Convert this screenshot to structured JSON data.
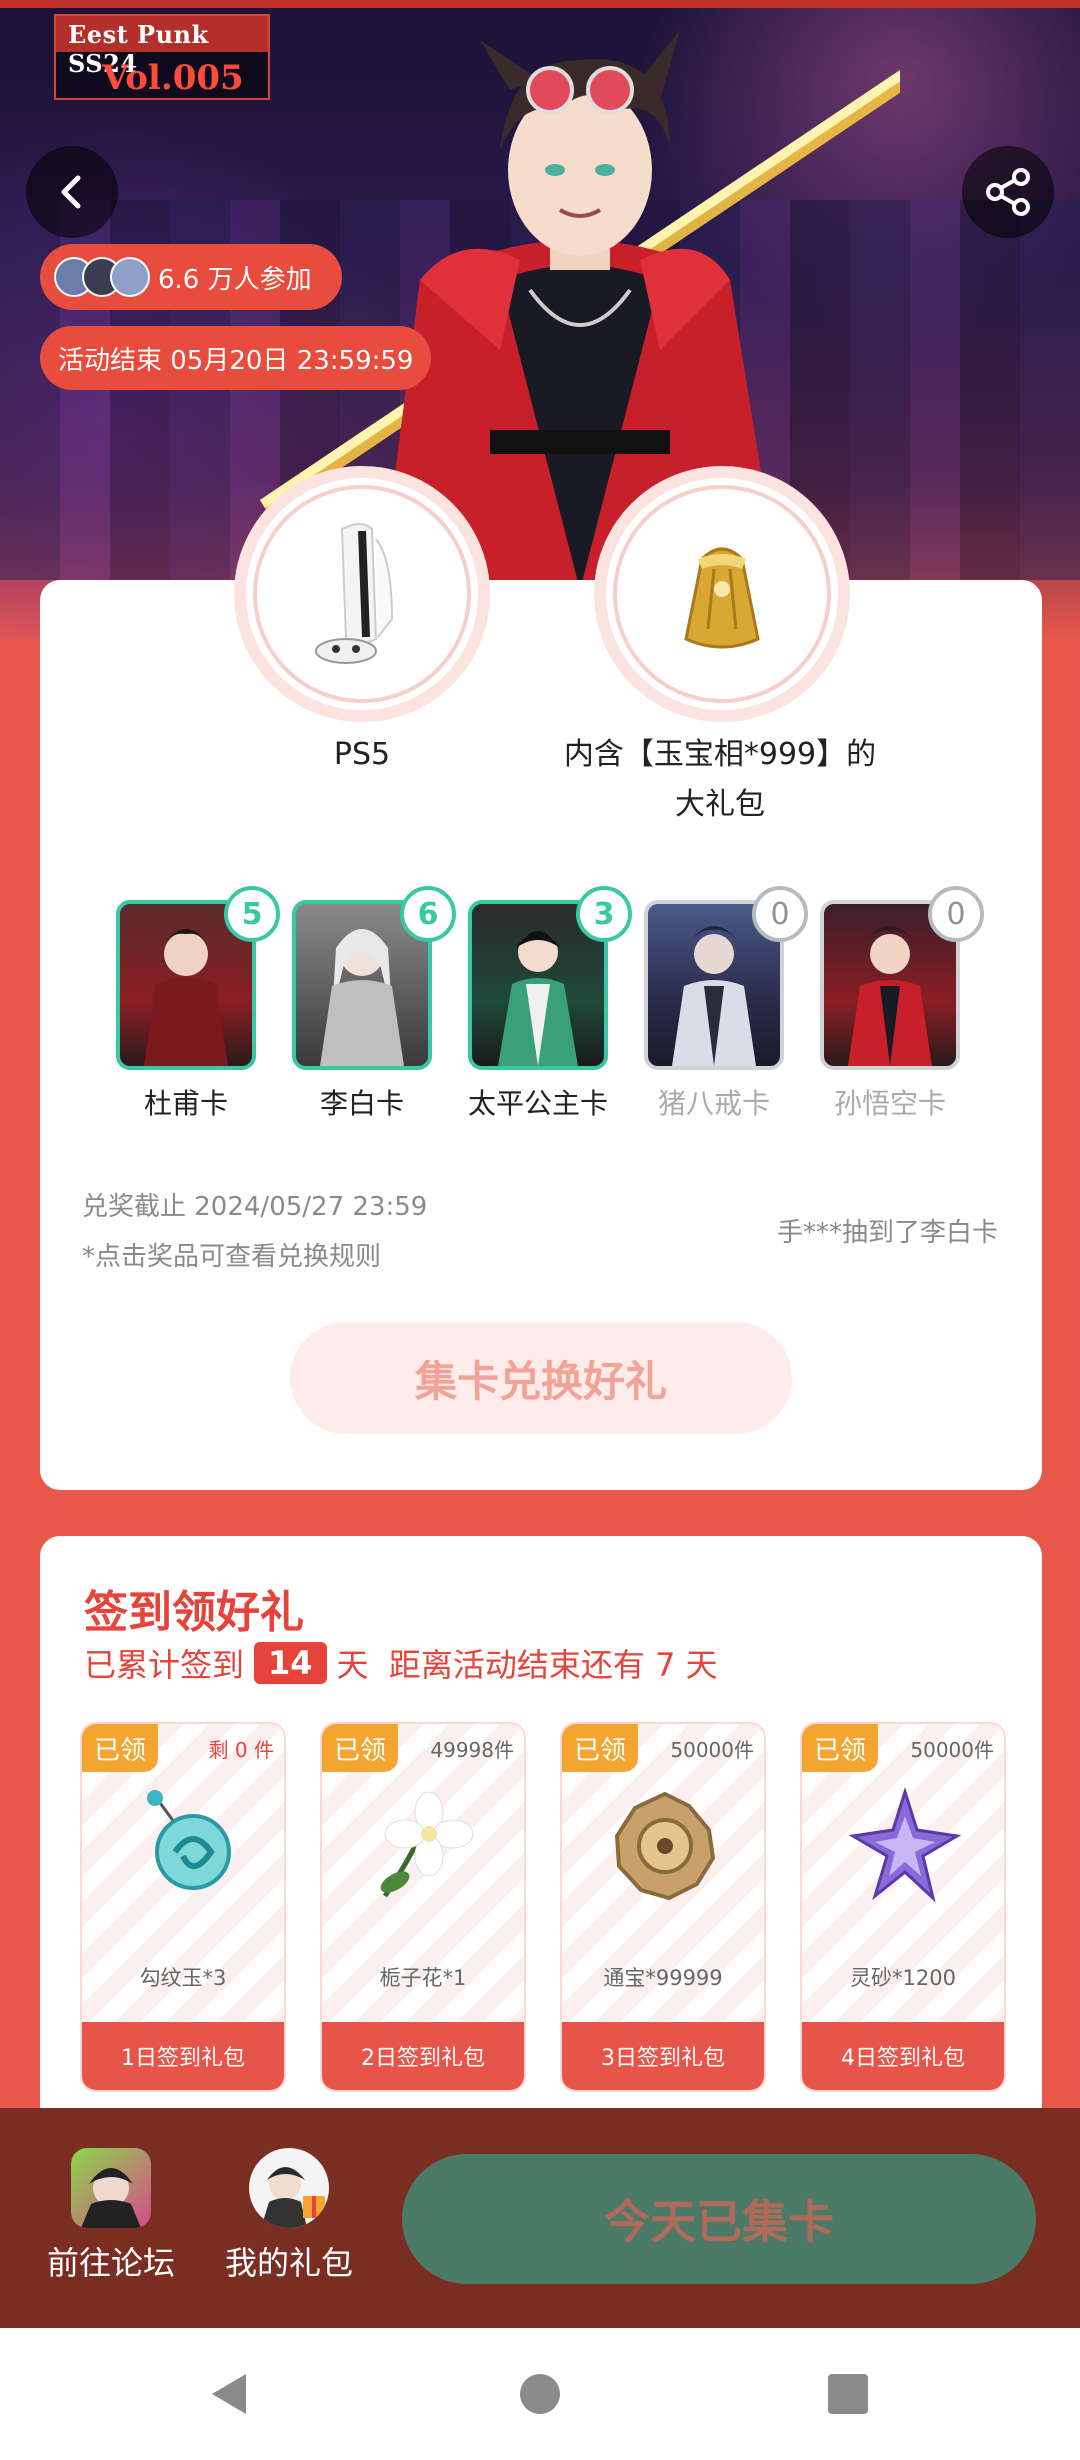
{
  "hero": {
    "badge_line1": "Eest Punk SS24",
    "badge_line2": "Vol.005",
    "participants_label": "6.6 万人参加",
    "countdown_label": "活动结束 05月20日 23:59:59"
  },
  "prizes": [
    {
      "label": "PS5"
    },
    {
      "label": "内含【玉宝相*999】的大礼包"
    }
  ],
  "collect_cards": [
    {
      "name": "杜甫卡",
      "count": "5",
      "owned": true
    },
    {
      "name": "李白卡",
      "count": "6",
      "owned": true
    },
    {
      "name": "太平公主卡",
      "count": "3",
      "owned": true
    },
    {
      "name": "猪八戒卡",
      "count": "0",
      "owned": false
    },
    {
      "name": "孙悟空卡",
      "count": "0",
      "owned": false
    }
  ],
  "redeem": {
    "deadline": "兑奖截止 2024/05/27 23:59",
    "rule_hint": "*点击奖品可查看兑换规则",
    "winner_ticker": "手***抽到了李白卡",
    "exchange_button": "集卡兑换好礼"
  },
  "signin": {
    "title": "签到领好礼",
    "stat_prefix": "已累计签到",
    "days": "14",
    "stat_suffix": "天  距离活动结束还有 7 天",
    "gifts": [
      {
        "tag": "已领",
        "stock": "剩 0 件",
        "name": "勾纹玉*3",
        "button": "1日签到礼包"
      },
      {
        "tag": "已领",
        "stock": "49998件",
        "name": "栀子花*1",
        "button": "2日签到礼包"
      },
      {
        "tag": "已领",
        "stock": "50000件",
        "name": "通宝*99999",
        "button": "3日签到礼包"
      },
      {
        "tag": "已领",
        "stock": "50000件",
        "name": "灵砂*1200",
        "button": "4日签到礼包"
      }
    ]
  },
  "bottom_bar": {
    "forum_label": "前往论坛",
    "my_gifts_label": "我的礼包",
    "today_button": "今天已集卡"
  },
  "colors": {
    "accent": "#e6443a",
    "card_owned": "#38c9a3",
    "tag": "#f4a531",
    "bottom_bar": "#7a2e22",
    "today_button": "#4b7a67"
  }
}
